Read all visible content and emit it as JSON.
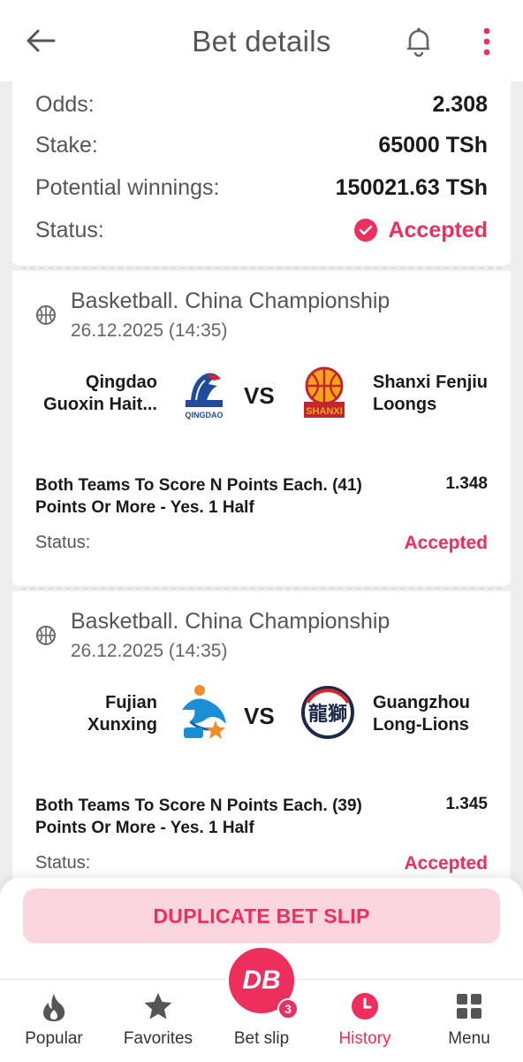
{
  "header": {
    "title": "Bet details"
  },
  "summary": {
    "odds_label": "Odds:",
    "odds_value": "2.308",
    "stake_label": "Stake:",
    "stake_value": "65000 TSh",
    "winnings_label": "Potential winnings:",
    "winnings_value": "150021.63 TSh",
    "status_label": "Status:",
    "status_value": "Accepted"
  },
  "events": [
    {
      "league": "Basketball. China Championship",
      "date": "26.12.2025 (14:35)",
      "home_line1": "Qingdao",
      "home_line2": "Guoxin Hait...",
      "vs": "VS",
      "away_line1": "Shanxi Fenjiu",
      "away_line2": "Loongs",
      "home_logo_text": "QINGDAO",
      "away_logo_text": "SHANXI",
      "market_line1": "Both Teams To Score N Points Each. (41)",
      "market_line2": "Points Or More - Yes. 1 Half",
      "odd": "1.348",
      "status_label": "Status:",
      "status_value": "Accepted"
    },
    {
      "league": "Basketball. China Championship",
      "date": "26.12.2025 (14:35)",
      "home_line1": "Fujian",
      "home_line2": "Xunxing",
      "vs": "VS",
      "away_line1": "Guangzhou",
      "away_line2": "Long-Lions",
      "away_logo_text": "龍獅",
      "market_line1": "Both Teams To Score N Points Each. (39)",
      "market_line2": "Points Or More - Yes. 1 Half",
      "odd": "1.345",
      "status_label": "Status:",
      "status_value": "Accepted"
    }
  ],
  "actions": {
    "duplicate_label": "DUPLICATE BET SLIP"
  },
  "nav": {
    "popular": "Popular",
    "favorites": "Favorites",
    "betslip": "Bet slip",
    "history": "History",
    "menu": "Menu",
    "betslip_logo": "DB",
    "betslip_count": "3"
  },
  "colors": {
    "accent": "#ee2e5c",
    "accent_soft": "#fcd6df",
    "background": "#eeeeee"
  }
}
